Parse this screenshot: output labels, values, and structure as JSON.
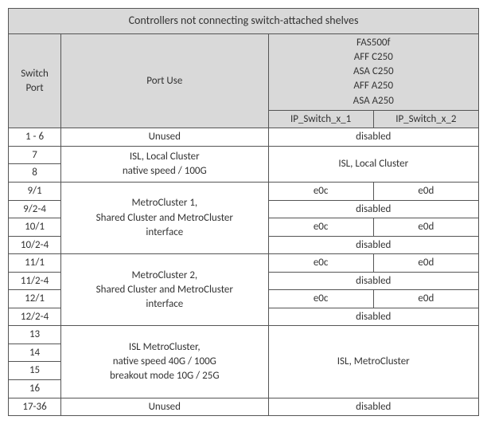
{
  "title": "Controllers not connecting switch-attached shelves",
  "headers": {
    "switch_port": "Switch Port",
    "port_use": "Port Use",
    "models": [
      "FAS500f",
      "AFF C250",
      "ASA C250",
      "AFF A250",
      "ASA A250"
    ],
    "ip_switch_1": "IP_Switch_x_1",
    "ip_switch_2": "IP_Switch_x_2"
  },
  "rows": {
    "r1_6": {
      "sp": "1 - 6",
      "use": "Unused",
      "v12": "disabled"
    },
    "r7": {
      "sp": "7",
      "use_l1": "ISL, Local Cluster",
      "v12": "ISL, Local Cluster"
    },
    "r8": {
      "sp": "8",
      "use_l2": "native speed / 100G"
    },
    "r9_1": {
      "sp": "9/1",
      "mc1_l1": "MetroCluster 1,",
      "v1": "e0c",
      "v2": "e0d"
    },
    "r9_24": {
      "sp": "9/2-4",
      "mc1_l2": "Shared Cluster and MetroCluster",
      "v12": "disabled"
    },
    "r10_1": {
      "sp": "10/1",
      "mc1_l3": "interface",
      "v1": "e0c",
      "v2": "e0d"
    },
    "r10_24": {
      "sp": "10/2-4",
      "v12": "disabled"
    },
    "r11_1": {
      "sp": "11/1",
      "mc2_l1": "MetroCluster 2,",
      "v1": "e0c",
      "v2": "e0d"
    },
    "r11_24": {
      "sp": "11/2-4",
      "mc2_l2": "Shared Cluster and MetroCluster",
      "v12": "disabled"
    },
    "r12_1": {
      "sp": "12/1",
      "mc2_l3": "interface",
      "v1": "e0c",
      "v2": "e0d"
    },
    "r12_24": {
      "sp": "12/2-4",
      "v12": "disabled"
    },
    "r13": {
      "sp": "13",
      "isl_l1": "ISL MetroCluster,",
      "v12": "ISL, MetroCluster"
    },
    "r14": {
      "sp": "14",
      "isl_l2": "native speed 40G / 100G"
    },
    "r15": {
      "sp": "15",
      "isl_l3": "breakout mode 10G / 25G"
    },
    "r16": {
      "sp": "16"
    },
    "r17_36": {
      "sp": "17-36",
      "use": "Unused",
      "v12": "disabled"
    }
  }
}
